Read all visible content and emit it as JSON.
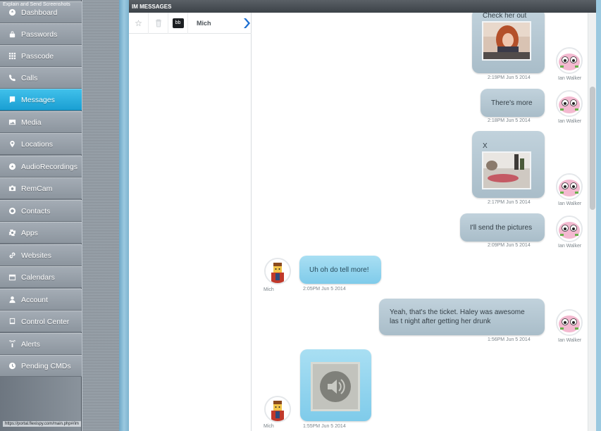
{
  "tooltip": "Explain and Send Screenshots",
  "status_url": "https://portal.flexispy.com/main.php#/im",
  "sidebar": {
    "items": [
      {
        "label": "Dashboard",
        "icon": "dashboard-icon"
      },
      {
        "label": "Passwords",
        "icon": "lock-icon"
      },
      {
        "label": "Passcode",
        "icon": "keypad-icon"
      },
      {
        "label": "Calls",
        "icon": "phone-icon"
      },
      {
        "label": "Messages",
        "icon": "message-icon"
      },
      {
        "label": "Media",
        "icon": "image-icon"
      },
      {
        "label": "Locations",
        "icon": "location-pin-icon"
      },
      {
        "label": "AudioRecordings",
        "icon": "microphone-icon"
      },
      {
        "label": "RemCam",
        "icon": "camera-icon"
      },
      {
        "label": "Contacts",
        "icon": "contact-icon"
      },
      {
        "label": "Apps",
        "icon": "gear-icon"
      },
      {
        "label": "Websites",
        "icon": "link-icon"
      },
      {
        "label": "Calendars",
        "icon": "calendar-icon"
      },
      {
        "label": "Account",
        "icon": "user-icon"
      },
      {
        "label": "Control Center",
        "icon": "monitor-icon"
      },
      {
        "label": "Alerts",
        "icon": "signal-icon"
      },
      {
        "label": "Pending CMDs",
        "icon": "clock-icon"
      }
    ],
    "active_index": 4,
    "active_color": "#1fa7d9"
  },
  "panel": {
    "title": "IM MESSAGES"
  },
  "contact": {
    "name": "Mich"
  },
  "messages": [
    {
      "dir": "out",
      "text": "Check her out",
      "media": "photo",
      "time": "2:19PM Jun 5 2014",
      "sender": "Ian Walker"
    },
    {
      "dir": "out",
      "text": "There's more",
      "time": "2:18PM Jun 5 2014",
      "sender": "Ian Walker"
    },
    {
      "dir": "out",
      "text": "X",
      "media": "photo",
      "time": "2:17PM Jun 5 2014",
      "sender": "Ian Walker"
    },
    {
      "dir": "out",
      "text": "I'll send the pictures",
      "time": "2:09PM Jun 5 2014",
      "sender": "Ian Walker"
    },
    {
      "dir": "in",
      "text": "Uh oh do tell more!",
      "time": "2:05PM Jun 5 2014",
      "sender": "Mich"
    },
    {
      "dir": "out",
      "text": "Yeah, that's the ticket. Haley was awesome las t night after getting her drunk",
      "time": "1:56PM Jun 5 2014",
      "sender": "Ian Walker"
    },
    {
      "dir": "in",
      "text": "",
      "media": "audio",
      "time": "1:55PM Jun 5 2014",
      "sender": "Mich"
    }
  ],
  "colors": {
    "outgoing_bubble": "#b4c6d1",
    "incoming_bubble": "#8fd3ee",
    "header": "#464c52"
  }
}
